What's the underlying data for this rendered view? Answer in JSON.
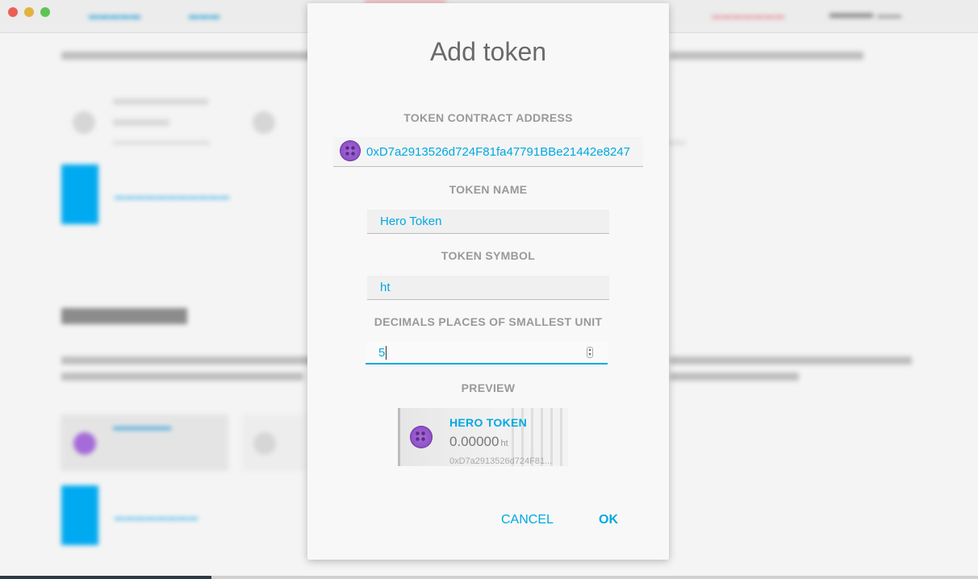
{
  "modal": {
    "title": "Add token",
    "contract_address_label": "TOKEN CONTRACT ADDRESS",
    "contract_address_value": "0xD7a2913526d724F81fa47791BBe21442e8247",
    "token_name_label": "TOKEN NAME",
    "token_name_value": "Hero Token",
    "token_symbol_label": "TOKEN SYMBOL",
    "token_symbol_value": "ht",
    "decimals_label": "DECIMALS PLACES OF SMALLEST UNIT",
    "decimals_value": "5",
    "preview_label": "PREVIEW",
    "preview": {
      "name": "HERO TOKEN",
      "amount": "0.00000",
      "unit": "ht",
      "address": "0xD7a2913526d724F81..."
    },
    "cancel_label": "CANCEL",
    "ok_label": "OK"
  },
  "colors": {
    "accent": "#00a9e0",
    "identicon": "#a86ad9"
  },
  "icons": {
    "token_identicon": "purple-identicon"
  }
}
